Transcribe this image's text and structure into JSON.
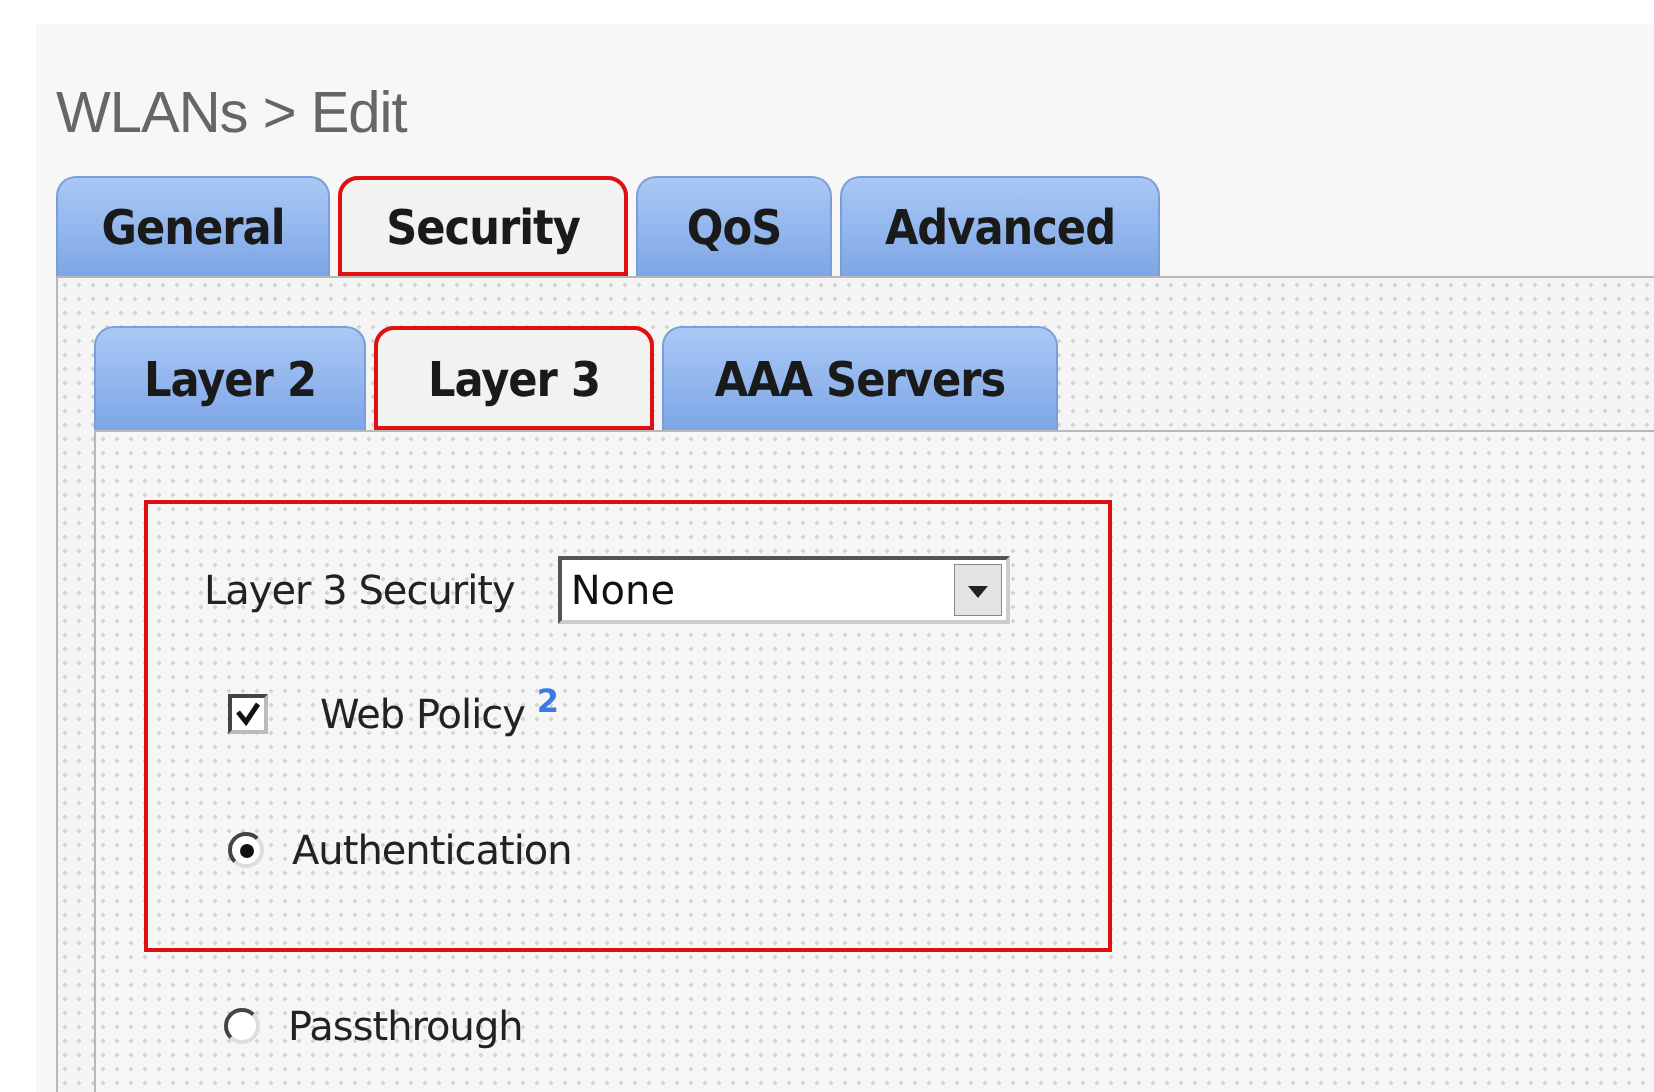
{
  "page": {
    "title": "WLANs > Edit"
  },
  "tabs": [
    {
      "label": "General",
      "selected": false,
      "highlighted": false
    },
    {
      "label": "Security",
      "selected": true,
      "highlighted": true
    },
    {
      "label": "QoS",
      "selected": false,
      "highlighted": false
    },
    {
      "label": "Advanced",
      "selected": false,
      "highlighted": false
    }
  ],
  "subtabs": [
    {
      "label": "Layer 2",
      "selected": false,
      "highlighted": false
    },
    {
      "label": "Layer 3",
      "selected": true,
      "highlighted": true
    },
    {
      "label": "AAA Servers",
      "selected": false,
      "highlighted": false
    }
  ],
  "form": {
    "highlighted": true,
    "security_label": "Layer 3 Security",
    "security_value": "None",
    "web_policy": {
      "label": "Web Policy",
      "footnote": "2",
      "checked": true
    },
    "options": [
      {
        "label": "Authentication",
        "selected": true
      },
      {
        "label": "Passthrough",
        "selected": false
      }
    ]
  }
}
